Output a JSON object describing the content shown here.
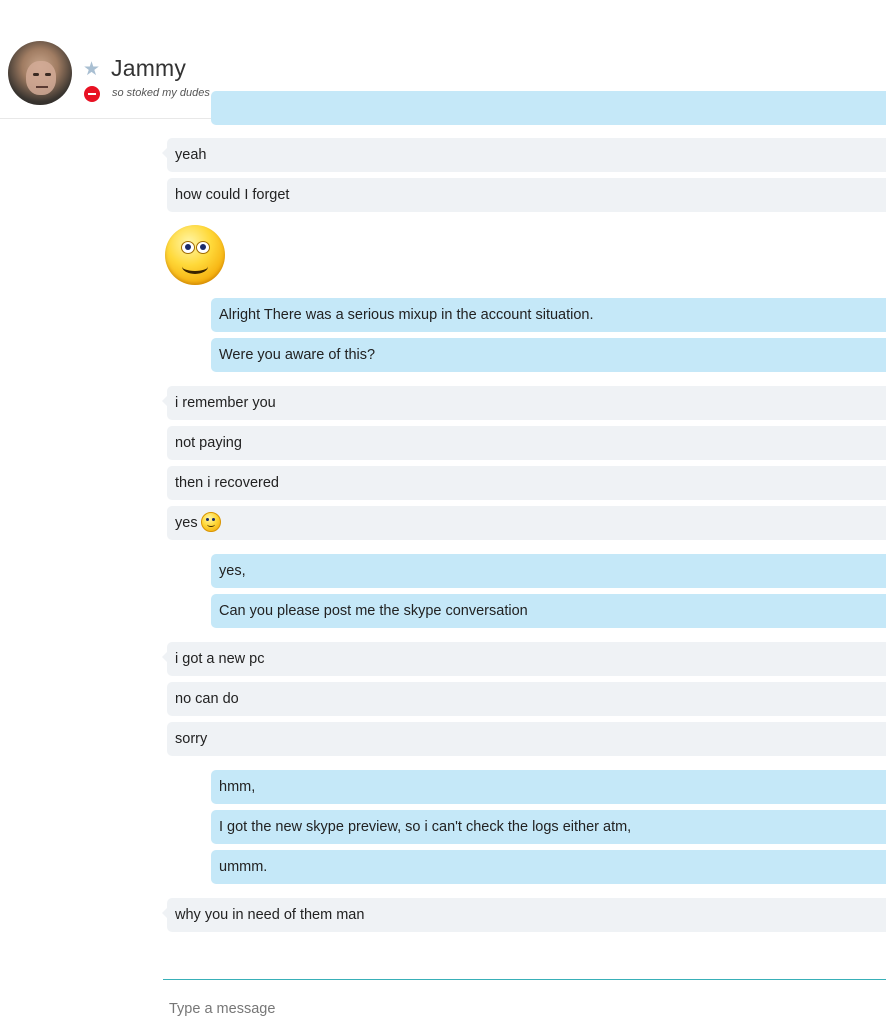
{
  "header": {
    "contact_name": "Jammy",
    "mood": "so stoked my dudes",
    "favorite_icon": "star-icon",
    "presence_status": "do-not-disturb",
    "presence_color": "#e81123"
  },
  "messages": [
    {
      "id": "m1",
      "direction": "in",
      "text": "yeah"
    },
    {
      "id": "m2",
      "direction": "in",
      "text": "how could I forget"
    },
    {
      "id": "m3",
      "direction": "in",
      "emoticon": "smile-emoticon"
    },
    {
      "id": "m4",
      "direction": "out",
      "text": "Alright There was a serious mixup in the account situation."
    },
    {
      "id": "m5",
      "direction": "out",
      "text": "Were you aware of this?"
    },
    {
      "id": "m6",
      "direction": "in",
      "text": "i remember you"
    },
    {
      "id": "m7",
      "direction": "in",
      "text": "not paying"
    },
    {
      "id": "m8",
      "direction": "in",
      "text": "then i recovered"
    },
    {
      "id": "m9",
      "direction": "in",
      "text": "yes",
      "emoticon": "smile-emoticon"
    },
    {
      "id": "m10",
      "direction": "out",
      "text": "yes,"
    },
    {
      "id": "m11",
      "direction": "out",
      "text": "Can you please post me the skype conversation"
    },
    {
      "id": "m12",
      "direction": "in",
      "text": "i got a new pc"
    },
    {
      "id": "m13",
      "direction": "in",
      "text": "no can do"
    },
    {
      "id": "m14",
      "direction": "in",
      "text": "sorry"
    },
    {
      "id": "m15",
      "direction": "out",
      "text": "hmm,"
    },
    {
      "id": "m16",
      "direction": "out",
      "text": "I got the new skype preview, so i can't check the logs either atm,"
    },
    {
      "id": "m17",
      "direction": "out",
      "text": "ummm."
    },
    {
      "id": "m18",
      "direction": "in",
      "text": "why you in need of them man"
    }
  ],
  "compose": {
    "placeholder": "Type a message",
    "value": ""
  },
  "colors": {
    "incoming_bubble": "#eff2f5",
    "outgoing_bubble": "#c5e8f8",
    "compose_border": "#38b0b8"
  }
}
